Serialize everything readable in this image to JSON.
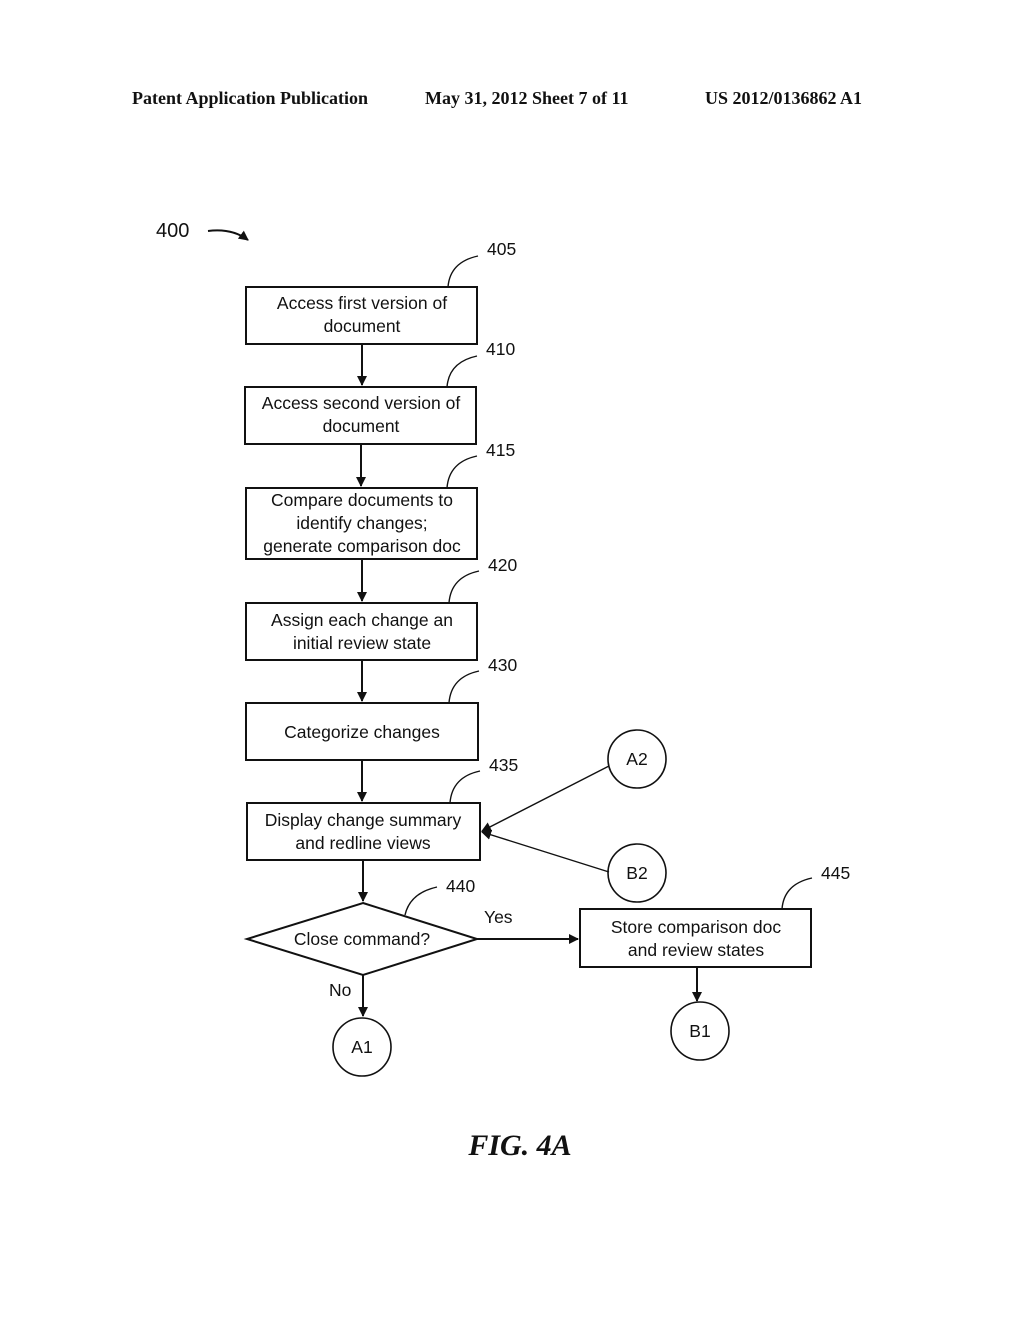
{
  "header": {
    "left": "Patent Application Publication",
    "middle": "May 31, 2012  Sheet 7 of 11",
    "right": "US 2012/0136862 A1"
  },
  "diagram": {
    "figure_ref": "400",
    "caption": "FIG. 4A",
    "steps": [
      {
        "ref": "405",
        "lines": [
          "Access first version of",
          "document"
        ]
      },
      {
        "ref": "410",
        "lines": [
          "Access second version of",
          "document"
        ]
      },
      {
        "ref": "415",
        "lines": [
          "Compare documents to",
          "identify changes;",
          "generate comparison doc"
        ]
      },
      {
        "ref": "420",
        "lines": [
          "Assign each change an",
          "initial review state"
        ]
      },
      {
        "ref": "430",
        "lines": [
          "Categorize changes"
        ]
      },
      {
        "ref": "435",
        "lines": [
          "Display change summary",
          "and redline views"
        ]
      }
    ],
    "decision": {
      "ref": "440",
      "label": "Close command?",
      "yes_label": "Yes",
      "no_label": "No"
    },
    "store_step": {
      "ref": "445",
      "lines": [
        "Store comparison doc",
        "and review states"
      ]
    },
    "connectors": {
      "a2": "A2",
      "b2": "B2",
      "a1": "A1",
      "b1": "B1"
    }
  }
}
